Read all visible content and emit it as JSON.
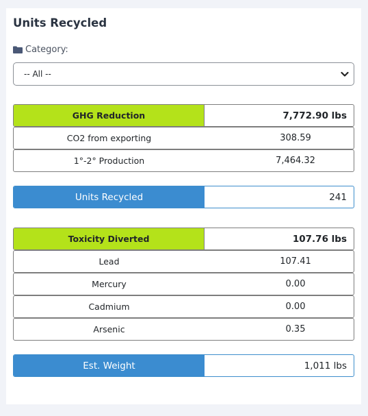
{
  "header": {
    "title": "Units Recycled"
  },
  "filter": {
    "category_label": "Category:",
    "category_icon": "folder-icon",
    "selected": "-- All --"
  },
  "ghg": {
    "label": "GHG Reduction",
    "total": "7,772.90 lbs",
    "items": [
      {
        "label": "CO2 from exporting",
        "value": "308.59"
      },
      {
        "label": "1°-2° Production",
        "value": "7,464.32"
      }
    ]
  },
  "units": {
    "label": "Units Recycled",
    "value": "241"
  },
  "toxicity": {
    "label": "Toxicity Diverted",
    "total": "107.76 lbs",
    "items": [
      {
        "label": "Lead",
        "value": "107.41"
      },
      {
        "label": "Mercury",
        "value": "0.00"
      },
      {
        "label": "Cadmium",
        "value": "0.00"
      },
      {
        "label": "Arsenic",
        "value": "0.35"
      }
    ]
  },
  "weight": {
    "label": "Est. Weight",
    "value": "1,011 lbs"
  },
  "colors": {
    "green_header": "#b4e21a",
    "blue_header": "#3b8cd0"
  }
}
